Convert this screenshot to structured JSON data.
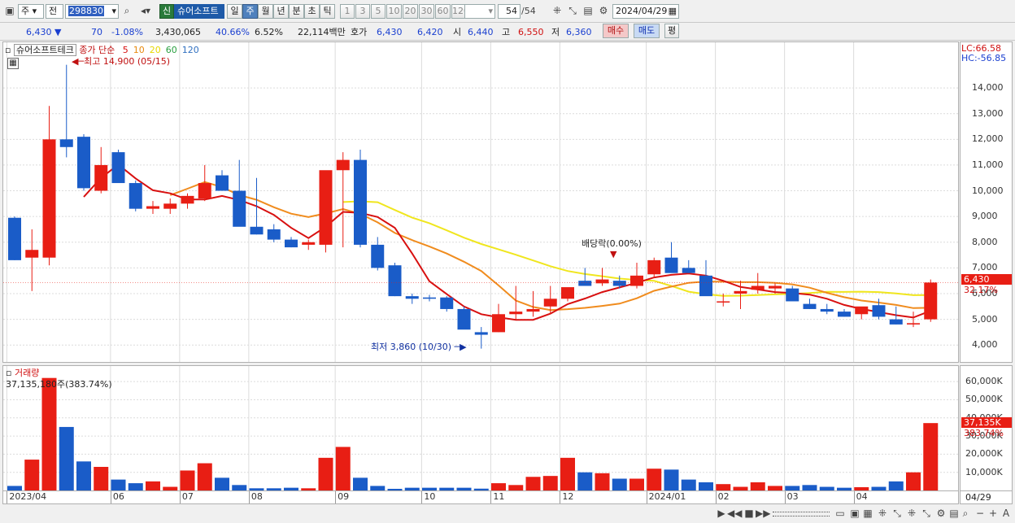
{
  "toolbar": {
    "market": "주",
    "market2": "전",
    "code": "298830",
    "credit_badge": "신",
    "stock_name": "슈어소프트",
    "periods": [
      "일",
      "주",
      "월",
      "년",
      "분",
      "초",
      "틱"
    ],
    "active_period": "주",
    "intervals": [
      "1",
      "3",
      "5",
      "10",
      "20",
      "30",
      "60",
      "120"
    ],
    "page": "54",
    "page_total": "/54",
    "date": "2024/04/29"
  },
  "quote": {
    "price": "6,430",
    "arrow": "▼",
    "change": "70",
    "change_pct": "-1.08%",
    "volume": "3,430,065",
    "vol_pct": "40.66%",
    "turnover": "6.52%",
    "amount": "22,114백만",
    "hoga_label": "호가",
    "ask": "6,430",
    "bid": "6,420",
    "open_label": "시",
    "open": "6,440",
    "high_label": "고",
    "high": "6,550",
    "low_label": "저",
    "low": "6,360",
    "buy_label": "매수",
    "sell_label": "매도",
    "flat_label": "평"
  },
  "price_panel": {
    "title": "슈어소프트테크",
    "ma_label": "종가 단순",
    "ma_periods": [
      "5",
      "10",
      "20",
      "60",
      "120"
    ],
    "ma_colors": [
      "#d81010",
      "#e88a10",
      "#e8d800",
      "#2aa040",
      "#3070c0"
    ],
    "max_label": "최고 14,900 (05/15)",
    "min_label": "최저 3,860 (10/30)",
    "dividend_label": "배당락(0.00%)",
    "lc": "LC:66.58",
    "hc": "HC:-56.85",
    "last_price": "6,430",
    "last_pct": "32.17%",
    "price_ticks": [
      "14,000",
      "13,000",
      "12,000",
      "11,000",
      "10,000",
      "9,000",
      "8,000",
      "7,000",
      "6,000",
      "5,000",
      "4,000"
    ]
  },
  "volume_panel": {
    "title": "거래량",
    "info": "37,135,180주(383.74%)",
    "ticks": [
      "60,000K",
      "50,000K",
      "40,000K",
      "30,000K",
      "20,000K",
      "10,000K"
    ],
    "last": "37,135K",
    "last_pct": "383.74%"
  },
  "x_labels": [
    "2023/04",
    "06",
    "07",
    "08",
    "09",
    "10",
    "11",
    "12",
    "2024/01",
    "02",
    "03",
    "04"
  ],
  "x_right": "04/29",
  "colors": {
    "up": "#e81e14",
    "down": "#1a5cc8",
    "ma5": "#d81010",
    "ma10": "#f08c1e",
    "ma20": "#f0e61e"
  },
  "chart_data": {
    "type": "candlestick",
    "x": [
      "2023/04/24",
      "05/01",
      "05/08",
      "05/15",
      "05/22",
      "05/29",
      "06/05",
      "06/12",
      "06/19",
      "06/26",
      "07/03",
      "07/10",
      "07/17",
      "07/24",
      "07/31",
      "08/07",
      "08/14",
      "08/21",
      "08/28",
      "09/04",
      "09/11",
      "09/18",
      "09/25",
      "10/02",
      "10/09",
      "10/16",
      "10/23",
      "10/30",
      "11/06",
      "11/13",
      "11/20",
      "11/27",
      "12/04",
      "12/11",
      "12/18",
      "12/25",
      "2024/01/01",
      "01/08",
      "01/15",
      "01/22",
      "01/29",
      "02/05",
      "02/12",
      "02/19",
      "02/26",
      "03/04",
      "03/11",
      "03/18",
      "03/25",
      "04/01",
      "04/08",
      "04/15",
      "04/22",
      "04/29"
    ],
    "open": [
      8950,
      7400,
      7400,
      12000,
      12100,
      10000,
      11500,
      10300,
      9300,
      9300,
      9500,
      9700,
      10600,
      10000,
      8600,
      8500,
      8100,
      7900,
      7900,
      10800,
      11200,
      7900,
      7100,
      5900,
      5850,
      5850,
      5400,
      4500,
      4500,
      5200,
      5300,
      5500,
      5800,
      6500,
      6400,
      6500,
      6300,
      6750,
      7400,
      7000,
      6700,
      5700,
      6000,
      6150,
      6200,
      6200,
      5600,
      5400,
      5300,
      5200,
      5550,
      5000,
      4800,
      5000
    ],
    "high": [
      9000,
      8500,
      13300,
      14900,
      12200,
      11700,
      11600,
      10400,
      9600,
      9700,
      9900,
      11000,
      10800,
      11200,
      10500,
      8700,
      8200,
      8100,
      8300,
      11500,
      11600,
      8200,
      7200,
      6000,
      5950,
      5900,
      5500,
      4700,
      5600,
      6300,
      6100,
      6300,
      6100,
      7000,
      7000,
      6700,
      7200,
      7400,
      8000,
      7300,
      7300,
      6000,
      6500,
      6800,
      6400,
      6300,
      5800,
      5600,
      5400,
      5300,
      5800,
      5500,
      5300,
      6550
    ],
    "low": [
      7300,
      6100,
      7100,
      11300,
      10000,
      9900,
      10300,
      9200,
      9100,
      9100,
      9300,
      9600,
      10000,
      8700,
      8300,
      8000,
      7800,
      7700,
      7600,
      7800,
      7800,
      6900,
      5900,
      5600,
      5700,
      5300,
      4700,
      3860,
      4500,
      5000,
      5100,
      5200,
      5700,
      6400,
      6300,
      6200,
      6200,
      6600,
      7100,
      6800,
      6500,
      5500,
      5400,
      6000,
      6000,
      5900,
      5400,
      5200,
      5100,
      5000,
      5000,
      4800,
      4700,
      4900
    ],
    "close": [
      7300,
      7700,
      12000,
      11700,
      10100,
      11000,
      10300,
      9300,
      9400,
      9500,
      9800,
      10300,
      10000,
      8600,
      8300,
      8100,
      7800,
      8000,
      10800,
      11200,
      7900,
      7000,
      5900,
      5800,
      5800,
      5400,
      4600,
      4400,
      5200,
      5300,
      5400,
      5800,
      6250,
      6300,
      6550,
      6300,
      6700,
      7300,
      6800,
      6800,
      5900,
      5700,
      6100,
      6300,
      6300,
      5700,
      5400,
      5300,
      5100,
      5500,
      5100,
      4800,
      4850,
      6430
    ],
    "volume": [
      2500,
      17000,
      62000,
      35000,
      16000,
      13000,
      6000,
      4000,
      5000,
      2000,
      11000,
      15000,
      7000,
      3000,
      1200,
      1200,
      1500,
      1200,
      18000,
      24000,
      7000,
      2500,
      900,
      1500,
      1500,
      1500,
      1500,
      1000,
      4000,
      3000,
      7500,
      8000,
      18000,
      10000,
      9500,
      6500,
      6500,
      12000,
      11500,
      6000,
      4500,
      3500,
      2000,
      4500,
      2500,
      2500,
      3000,
      2000,
      1500,
      1800,
      2000,
      5000,
      10000,
      37135
    ],
    "ylim": [
      3500,
      15300
    ],
    "volume_ylim": [
      0,
      65000
    ]
  }
}
